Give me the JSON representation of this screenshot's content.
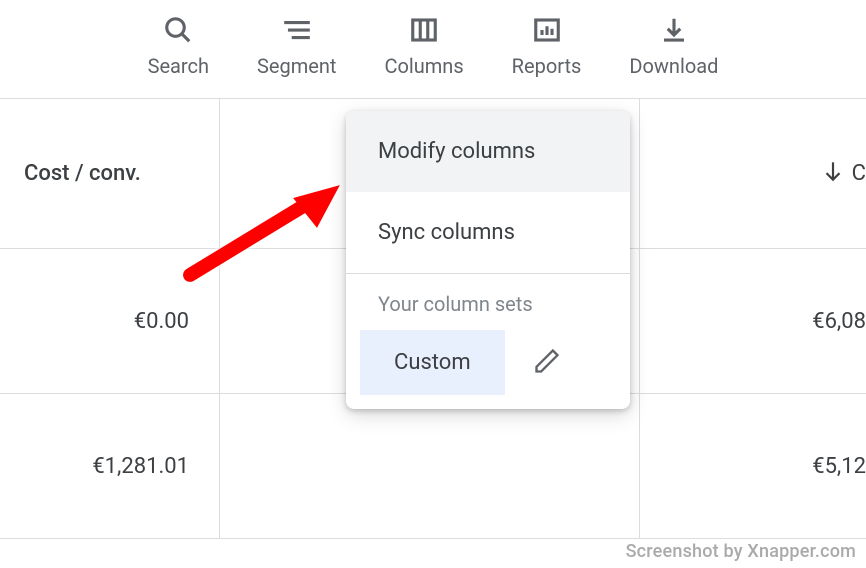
{
  "toolbar": {
    "search": "Search",
    "segment": "Segment",
    "columns": "Columns",
    "reports": "Reports",
    "download": "Download"
  },
  "table": {
    "header": {
      "col1": "Cost / conv.",
      "col3_partial": "C"
    },
    "rows": [
      {
        "col1": "€0.00",
        "col3": "€6,08"
      },
      {
        "col1": "€1,281.01",
        "col3": "€5,12"
      }
    ]
  },
  "dropdown": {
    "modify": "Modify columns",
    "sync": "Sync columns",
    "section_label": "Your column sets",
    "custom": "Custom"
  },
  "watermark": "Screenshot by Xnapper.com"
}
